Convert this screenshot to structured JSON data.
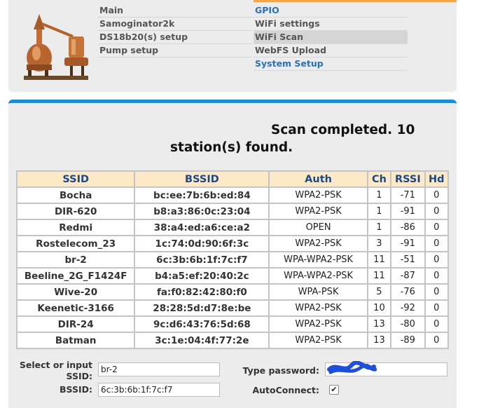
{
  "nav": {
    "left": [
      {
        "label": "Main"
      },
      {
        "label": "Samoginator2k"
      },
      {
        "label": "DS18b20(s) setup"
      },
      {
        "label": "Pump setup"
      }
    ],
    "right": [
      {
        "label": "GPIO"
      },
      {
        "label": "WiFi settings"
      },
      {
        "label": "WiFi Scan"
      },
      {
        "label": "WebFS Upload"
      },
      {
        "label": "System Setup"
      }
    ]
  },
  "scan": {
    "title_line1": "Scan completed. 10",
    "title_line2": "station(s) found."
  },
  "table": {
    "headers": [
      "SSID",
      "BSSID",
      "Auth",
      "Ch",
      "RSSI",
      "Hd"
    ],
    "rows": [
      [
        "Bocha",
        "bc:ee:7b:6b:ed:84",
        "WPA2-PSK",
        "1",
        "-71",
        "0"
      ],
      [
        "DIR-620",
        "b8:a3:86:0c:23:04",
        "WPA2-PSK",
        "1",
        "-91",
        "0"
      ],
      [
        "Redmi",
        "38:a4:ed:a6:ce:a2",
        "OPEN",
        "1",
        "-86",
        "0"
      ],
      [
        "Rostelecom_23",
        "1c:74:0d:90:6f:3c",
        "WPA2-PSK",
        "3",
        "-91",
        "0"
      ],
      [
        "br-2",
        "6c:3b:6b:1f:7c:f7",
        "WPA-WPA2-PSK",
        "11",
        "-51",
        "0"
      ],
      [
        "Beeline_2G_F1424F",
        "b4:a5:ef:20:40:2c",
        "WPA-WPA2-PSK",
        "11",
        "-87",
        "0"
      ],
      [
        "Wive-20",
        "fa:f0:82:42:80:f0",
        "WPA-PSK",
        "5",
        "-76",
        "0"
      ],
      [
        "Keenetic-3166",
        "28:28:5d:d7:8e:be",
        "WPA2-PSK",
        "10",
        "-92",
        "0"
      ],
      [
        "DIR-24",
        "9c:d6:43:76:5d:68",
        "WPA2-PSK",
        "13",
        "-80",
        "0"
      ],
      [
        "Batman",
        "3c:1e:04:4f:77:2e",
        "WPA2-PSK",
        "13",
        "-89",
        "0"
      ]
    ]
  },
  "form": {
    "ssid_label_1": "Select or input",
    "ssid_label_2": "SSID:",
    "ssid_value": "br-2",
    "bssid_label": "BSSID:",
    "bssid_value": "6c:3b:6b:1f:7c:f7",
    "password_label": "Type password:",
    "autoconnect_label": "AutoConnect:",
    "autoconnect_checked": true
  },
  "colors": {
    "accent_blue": "#1f8bd0",
    "link_blue": "#2a72b5",
    "header_orange": "#f3a64a",
    "table_header_bg": "#fde9c6"
  }
}
